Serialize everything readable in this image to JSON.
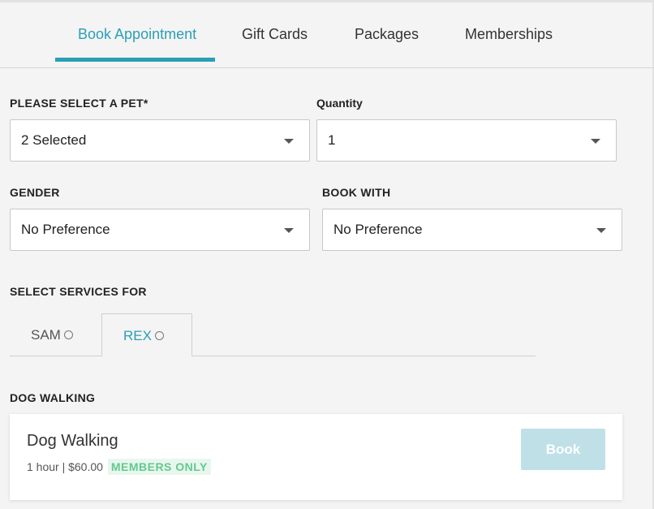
{
  "tabs": [
    {
      "label": "Book Appointment"
    },
    {
      "label": "Gift Cards"
    },
    {
      "label": "Packages"
    },
    {
      "label": "Memberships"
    }
  ],
  "form": {
    "pet_label": "PLEASE SELECT A PET*",
    "pet_value": "2 Selected",
    "quantity_label": "Quantity",
    "quantity_value": "1",
    "gender_label": "GENDER",
    "gender_value": "No Preference",
    "book_with_label": "BOOK WITH",
    "book_with_value": "No Preference"
  },
  "services": {
    "section_label": "SELECT SERVICES FOR",
    "pets": [
      {
        "name": "SAM"
      },
      {
        "name": "REX"
      }
    ],
    "category_label": "DOG WALKING",
    "items": [
      {
        "name": "Dog Walking",
        "meta": "1 hour | $60.00",
        "badge": "MEMBERS ONLY",
        "action": "Book"
      }
    ]
  },
  "colors": {
    "accent": "#2b9fb5",
    "badge_text": "#63c98e",
    "book_button": "#bfe0e7"
  }
}
